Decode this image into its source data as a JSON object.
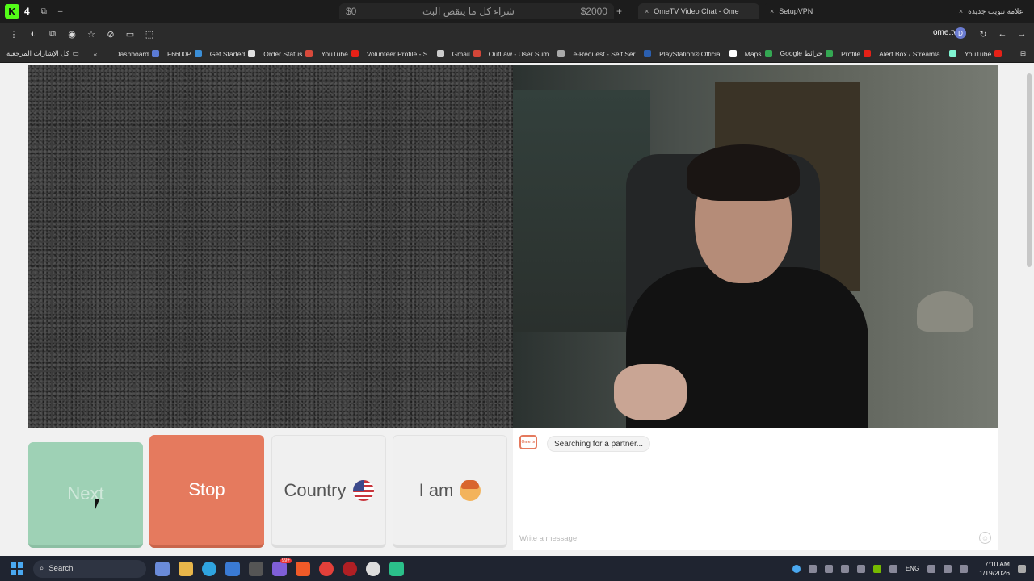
{
  "window": {
    "logo_letter": "K",
    "count": "4"
  },
  "tabs": {
    "ad_left": "$0",
    "ad_middle": "شراء كل ما ينقص البث",
    "ad_right": "$2000",
    "ome": "OmeTV Video Chat - Ome",
    "vpn": "SetupVPN",
    "new_tab": "علامة تبويب جديدة"
  },
  "toolbar": {
    "url": "ome.tv",
    "profile_initial": "D"
  },
  "bookmarks": {
    "all": "كل الإشارات المرجعية",
    "items": [
      {
        "label": "Dashboard",
        "color": "#5b7bd5"
      },
      {
        "label": "F6600P",
        "color": "#3b8fd8"
      },
      {
        "label": "Get Started",
        "color": "#e0e0e0"
      },
      {
        "label": "Order Status",
        "color": "#d84a3b"
      },
      {
        "label": "YouTube",
        "color": "#e62117"
      },
      {
        "label": "Volunteer Profile - S...",
        "color": "#cccccc"
      },
      {
        "label": "Gmail",
        "color": "#d44638"
      },
      {
        "label": "OutLaw - User Sum...",
        "color": "#aaaaaa"
      },
      {
        "label": "e-Request - Self Ser...",
        "color": "#2b5fb0"
      },
      {
        "label": "PlayStation® Officia...",
        "color": "#ffffff"
      },
      {
        "label": "Maps",
        "color": "#34a853"
      },
      {
        "label": "Google خرائط",
        "color": "#34a853"
      },
      {
        "label": "Profile",
        "color": "#e62117"
      },
      {
        "label": "Alert Box / Streamla...",
        "color": "#80f5d2"
      },
      {
        "label": "YouTube",
        "color": "#e62117"
      }
    ]
  },
  "controls": {
    "next": "Next",
    "stop": "Stop",
    "country": "Country",
    "i_am": "I am"
  },
  "chat": {
    "logo": "Ome tv",
    "status": "Searching for a partner...",
    "placeholder": "Write a message"
  },
  "taskbar": {
    "search": "Search",
    "lang": "ENG",
    "time": "7:10 AM",
    "date": "1/19/2026",
    "badge": "99+"
  }
}
